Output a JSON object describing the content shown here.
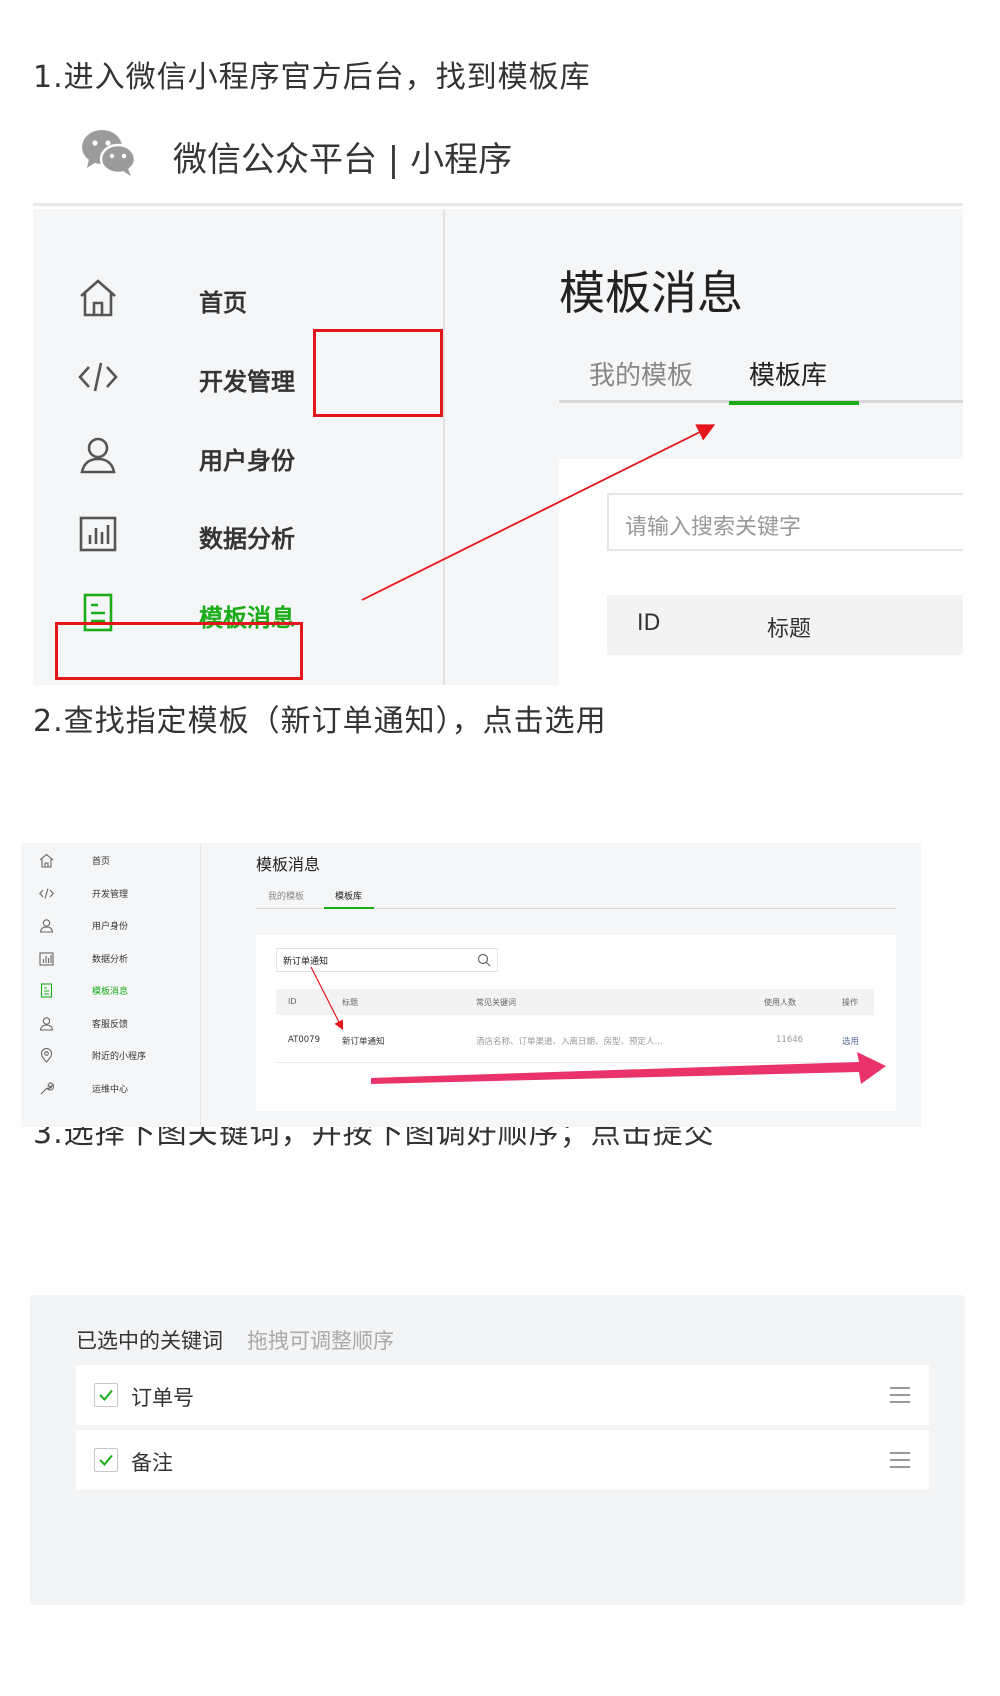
{
  "steps": [
    {
      "title": "1.进入微信小程序官方后台，找到模板库"
    },
    {
      "title": "2.查找指定模板（新订单通知），点击选用"
    },
    {
      "title": "3.选择下图关键词，并按下图调好顺序；点击提交"
    }
  ],
  "shot1": {
    "brand": "微信公众平台  |  小程序",
    "nav": [
      {
        "label": "首页",
        "icon": "home-icon"
      },
      {
        "label": "开发管理",
        "icon": "code-icon"
      },
      {
        "label": "用户身份",
        "icon": "user-icon"
      },
      {
        "label": "数据分析",
        "icon": "chart-icon"
      },
      {
        "label": "模板消息",
        "icon": "template-icon",
        "active": true
      }
    ],
    "page_title": "模板消息",
    "tabs": [
      {
        "label": "我的模板"
      },
      {
        "label": "模板库",
        "active": true
      }
    ],
    "search_placeholder": "请输入搜索关键字",
    "table_headers": [
      "ID",
      "标题"
    ]
  },
  "shot2": {
    "nav": [
      {
        "label": "首页",
        "icon": "home-icon"
      },
      {
        "label": "开发管理",
        "icon": "code-icon"
      },
      {
        "label": "用户身份",
        "icon": "user-icon"
      },
      {
        "label": "数据分析",
        "icon": "chart-icon"
      },
      {
        "label": "模板消息",
        "icon": "template-icon",
        "active": true
      },
      {
        "label": "客服反馈",
        "icon": "service-icon"
      },
      {
        "label": "附近的小程序",
        "icon": "location-icon"
      },
      {
        "label": "运维中心",
        "icon": "wrench-icon"
      }
    ],
    "page_title": "模板消息",
    "tabs": [
      {
        "label": "我的模板"
      },
      {
        "label": "模板库",
        "active": true
      }
    ],
    "search_value": "新订单通知",
    "table_headers": [
      "ID",
      "标题",
      "常见关键词",
      "使用人数",
      "操作"
    ],
    "row": {
      "id": "AT0079",
      "title": "新订单通知",
      "keywords": "酒店名称、订单渠道、入离日期、房型、预定人...",
      "users": "11646",
      "action": "选用"
    }
  },
  "shot3": {
    "heading": "已选中的关键词",
    "hint": "拖拽可调整顺序",
    "keywords": [
      {
        "label": "订单号",
        "checked": true
      },
      {
        "label": "备注",
        "checked": true
      }
    ]
  },
  "colors": {
    "accent_green": "#1aad19",
    "highlight_red": "#e5161b",
    "arrow_pink": "#e9336a",
    "link_blue": "#576b95"
  }
}
